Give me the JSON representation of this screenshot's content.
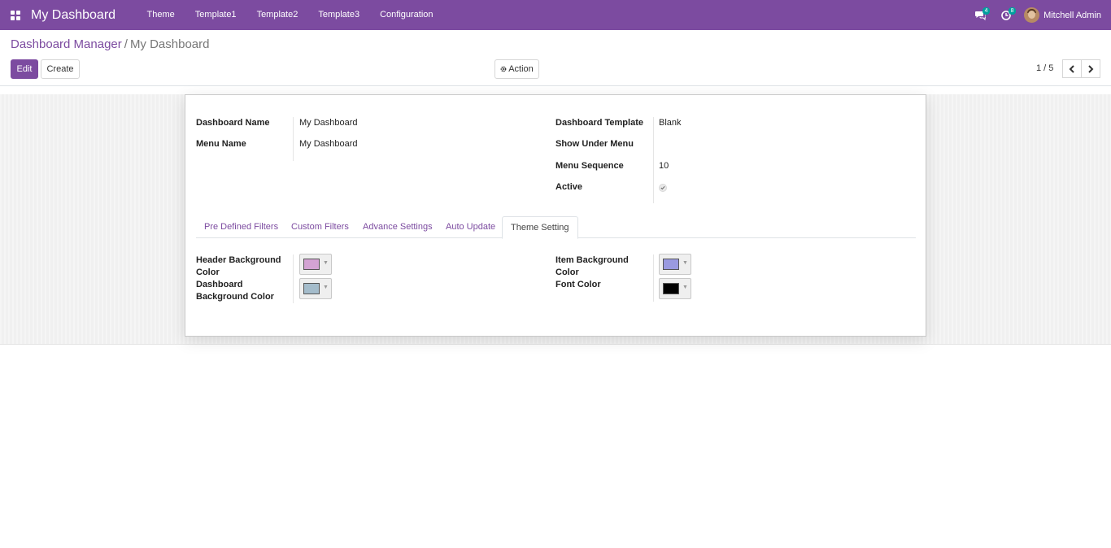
{
  "navbar": {
    "app_title": "My Dashboard",
    "menu": [
      "Theme",
      "Template1",
      "Template2",
      "Template3",
      "Configuration"
    ],
    "messages_count": "4",
    "activities_count": "8",
    "user_name": "Mitchell Admin"
  },
  "breadcrumb": {
    "parent": "Dashboard Manager",
    "separator": "/",
    "current": "My Dashboard"
  },
  "toolbar": {
    "edit_label": "Edit",
    "create_label": "Create",
    "action_label": "Action",
    "pager_value": "1 / 5"
  },
  "form": {
    "left_fields": [
      {
        "label": "Dashboard Name",
        "value": "My Dashboard"
      },
      {
        "label": "Menu Name",
        "value": "My Dashboard"
      }
    ],
    "right_fields": [
      {
        "label": "Dashboard Template",
        "value": "Blank"
      },
      {
        "label": "Show Under Menu",
        "value": ""
      },
      {
        "label": "Menu Sequence",
        "value": "10"
      },
      {
        "label": "Active",
        "value": true
      }
    ],
    "tabs": [
      "Pre Defined Filters",
      "Custom Filters",
      "Advance Settings",
      "Auto Update",
      "Theme Setting"
    ],
    "active_tab": "Theme Setting",
    "theme_settings": {
      "header_bg_label_line1": "Header Background",
      "header_bg_label_line2": "Color",
      "header_bg_color": "#d3a3d3",
      "dashboard_bg_label_line1": "Dashboard",
      "dashboard_bg_label_line2": "Background Color",
      "dashboard_bg_color": "#a4bccb",
      "item_bg_label_line1": "Item Background",
      "item_bg_label_line2": "Color",
      "item_bg_color": "#9a9ae0",
      "font_color_label": "Font Color",
      "font_color": "#000000"
    }
  },
  "colors": {
    "brand": "#7c4ba0",
    "badge": "#00a09d"
  }
}
